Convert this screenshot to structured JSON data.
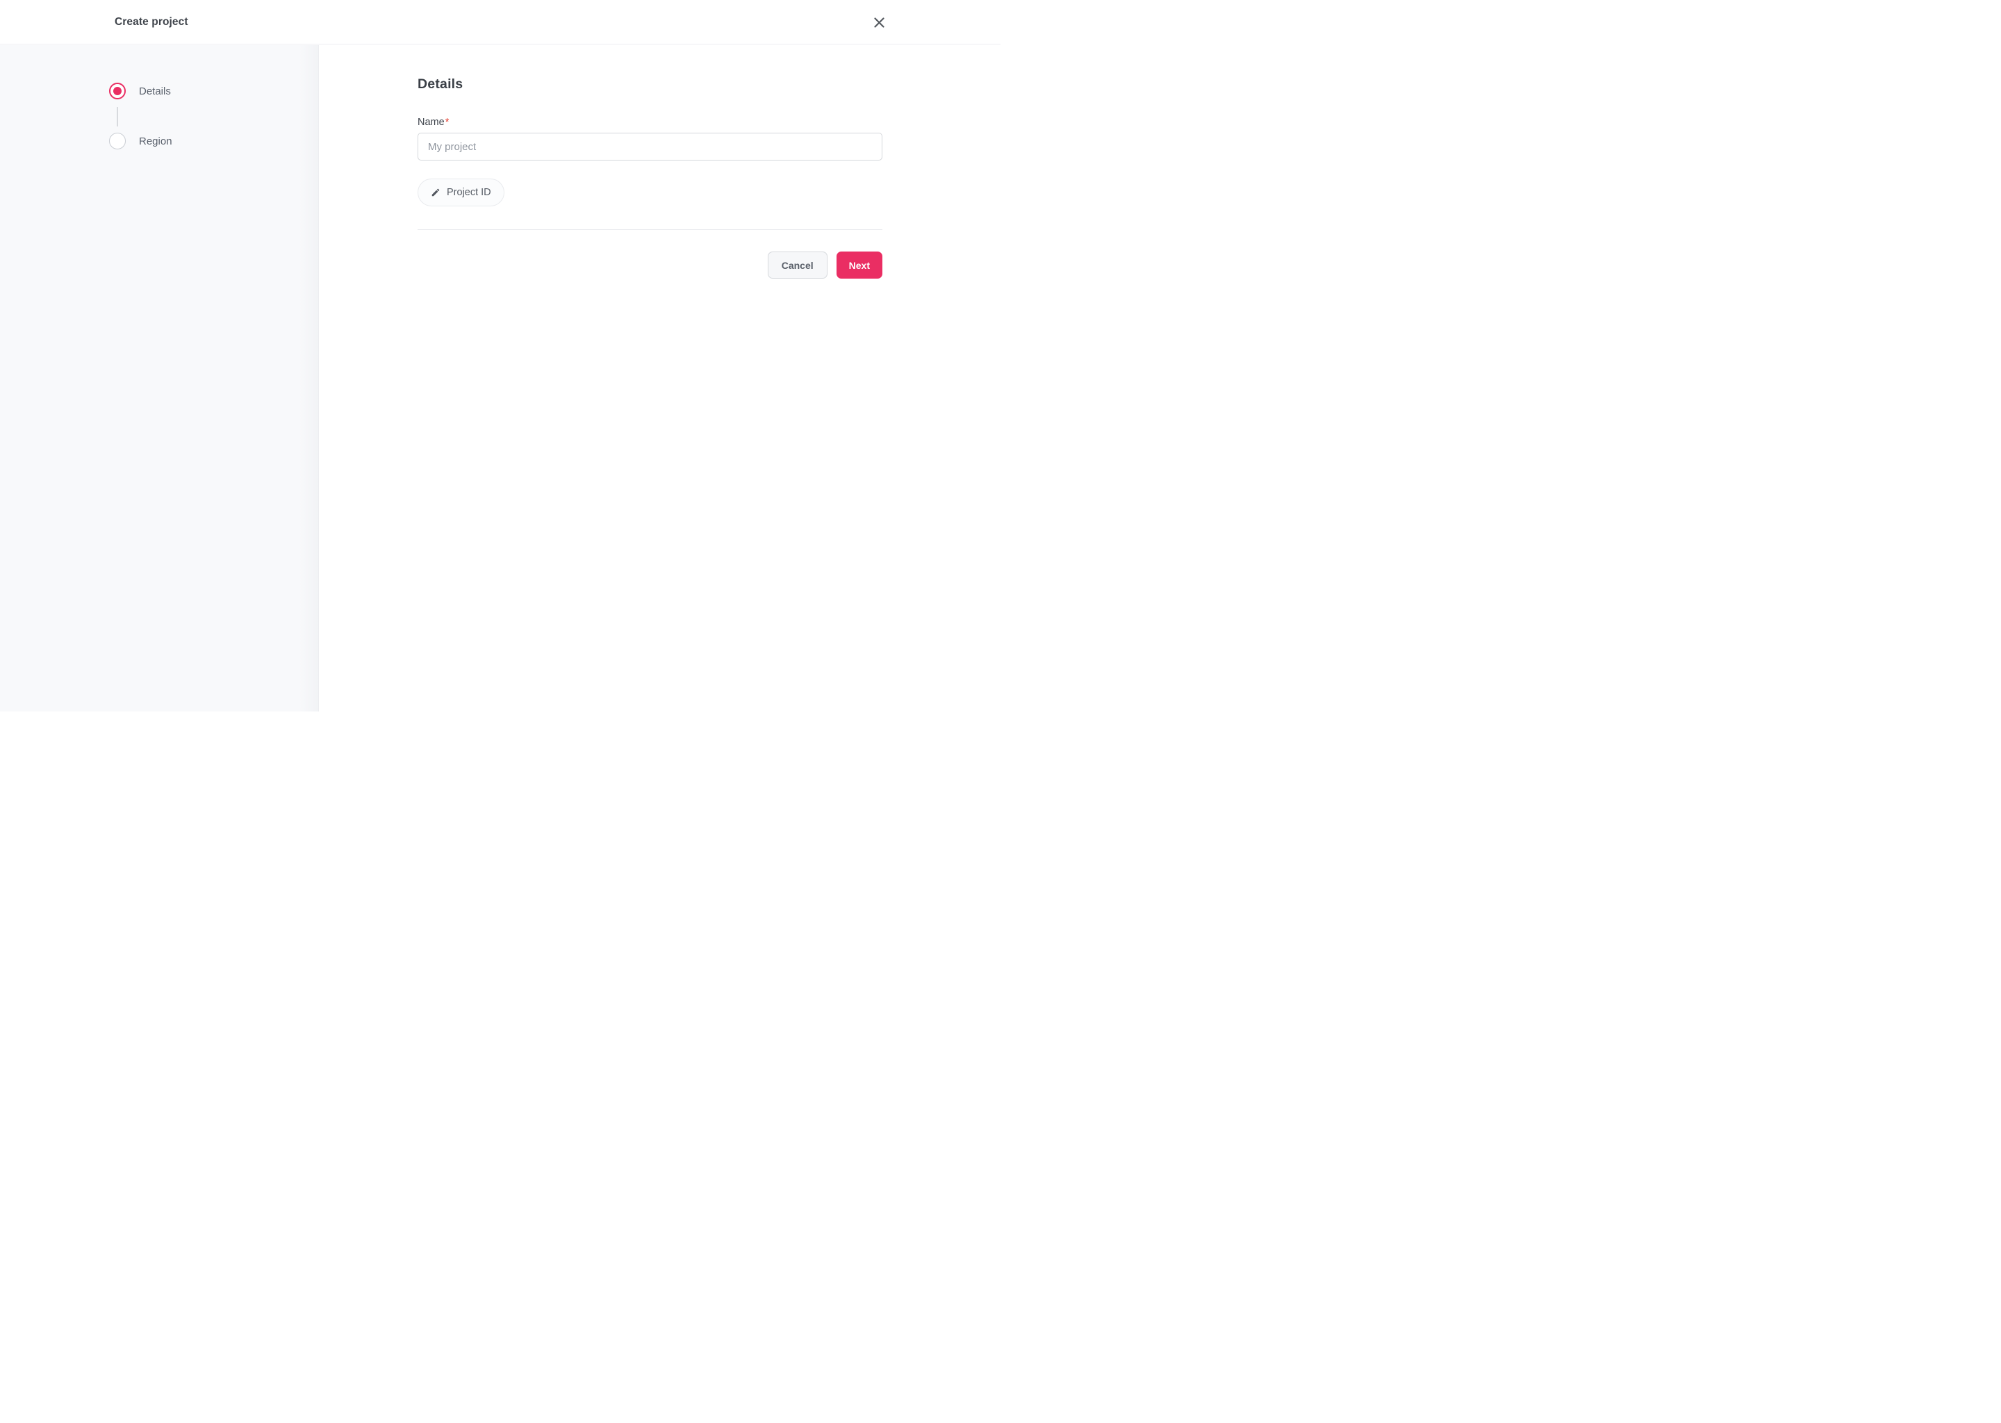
{
  "header": {
    "title": "Create project",
    "close_icon": "close-icon"
  },
  "stepper": {
    "items": [
      {
        "label": "Details",
        "state": "active"
      },
      {
        "label": "Region",
        "state": "inactive"
      }
    ]
  },
  "main": {
    "heading": "Details"
  },
  "form": {
    "name_label": "Name",
    "required_marker": "*",
    "name_placeholder": "My project",
    "name_value": "",
    "project_id_button": "Project ID",
    "project_id_icon": "pencil-icon"
  },
  "footer": {
    "cancel_label": "Cancel",
    "next_label": "Next"
  },
  "colors": {
    "accent": "#ea2e63",
    "required": "#e53e30",
    "sidebar_bg": "#f8f9fb"
  }
}
